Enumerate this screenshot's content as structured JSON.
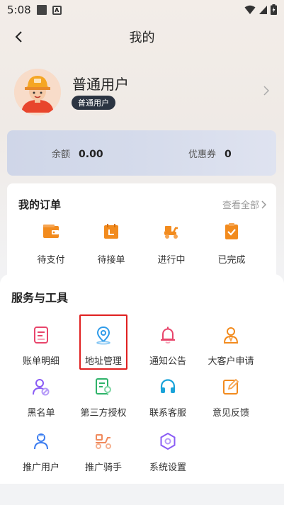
{
  "status_bar": {
    "time": "5:08"
  },
  "nav": {
    "title": "我的"
  },
  "profile": {
    "name": "普通用户",
    "badge": "普通用户"
  },
  "balance": {
    "balance_label": "余额",
    "balance_value": "0.00",
    "coupon_label": "优惠券",
    "coupon_value": "0"
  },
  "orders": {
    "title": "我的订单",
    "more": "查看全部",
    "items": [
      {
        "label": "待支付",
        "icon": "wallet-icon"
      },
      {
        "label": "待接单",
        "icon": "calendar-icon"
      },
      {
        "label": "进行中",
        "icon": "scooter-icon"
      },
      {
        "label": "已完成",
        "icon": "check-document-icon"
      }
    ]
  },
  "services": {
    "title": "服务与工具",
    "items": [
      {
        "label": "账单明细",
        "icon": "bill-icon"
      },
      {
        "label": "地址管理",
        "icon": "location-icon"
      },
      {
        "label": "通知公告",
        "icon": "bell-icon"
      },
      {
        "label": "大客户申请",
        "icon": "vip-user-icon"
      },
      {
        "label": "黑名单",
        "icon": "block-user-icon"
      },
      {
        "label": "第三方授权",
        "icon": "authorize-icon"
      },
      {
        "label": "联系客服",
        "icon": "headset-icon"
      },
      {
        "label": "意见反馈",
        "icon": "feedback-icon"
      },
      {
        "label": "推广用户",
        "icon": "promote-user-icon"
      },
      {
        "label": "推广骑手",
        "icon": "promote-rider-icon"
      },
      {
        "label": "系统设置",
        "icon": "settings-icon"
      }
    ]
  },
  "colors": {
    "accent_orange": "#f28b1e",
    "badge_dark": "#2b3442",
    "highlight_red": "#e02020"
  }
}
